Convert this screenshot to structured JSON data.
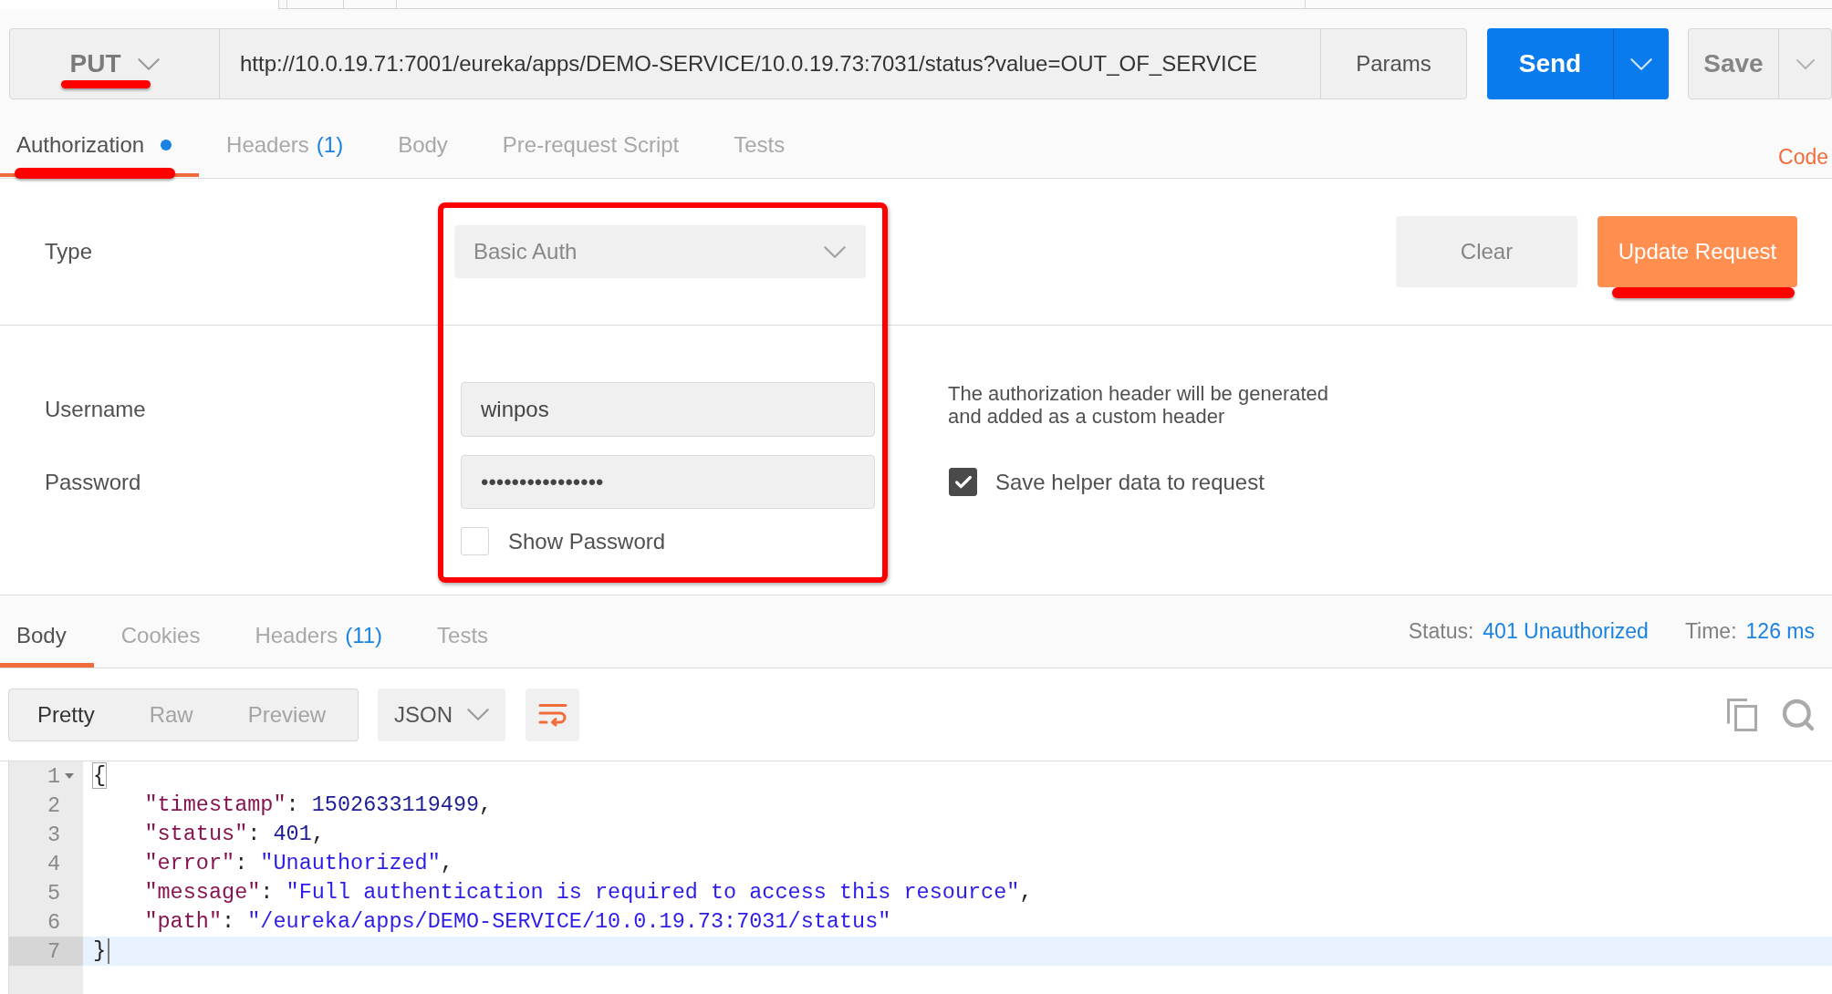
{
  "request": {
    "method": {
      "label": "PUT",
      "marked": true
    },
    "url": "http://10.0.19.71:7001/eureka/apps/DEMO-SERVICE/10.0.19.73:7031/status?value=OUT_OF_SERVICE",
    "params": "Params",
    "send": "Send",
    "save": "Save"
  },
  "request_tabs": [
    {
      "label": "Authorization",
      "selected": true,
      "modified": true,
      "marked": true
    },
    {
      "label": "Headers",
      "count": "(1)",
      "selected": false,
      "modified": false,
      "marked": false
    },
    {
      "label": "Body",
      "selected": false,
      "modified": false,
      "marked": false
    },
    {
      "label": "Pre-request Script",
      "selected": false,
      "modified": false,
      "marked": false
    },
    {
      "label": "Tests",
      "selected": false,
      "modified": false,
      "marked": false
    }
  ],
  "code_link": "Code",
  "auth": {
    "type_label": "Type",
    "type_value": "Basic Auth",
    "fields_marked": true,
    "buttons": [
      {
        "label": "Clear",
        "kind": "secondary",
        "marked": false
      },
      {
        "label": "Update Request",
        "kind": "primary",
        "marked": true
      }
    ],
    "username_label": "Username",
    "username": "winpos",
    "password_label": "Password",
    "password": "••••••••••••••••",
    "show_password": {
      "label": "Show Password",
      "checked": false
    },
    "note": "The authorization header will be generated and added as a custom header",
    "save_helper": {
      "label": "Save helper data to request",
      "checked": true
    }
  },
  "response": {
    "tabs": [
      {
        "label": "Body",
        "selected": true
      },
      {
        "label": "Cookies",
        "selected": false
      },
      {
        "label": "Headers",
        "count": "(11)",
        "selected": false
      },
      {
        "label": "Tests",
        "selected": false
      }
    ],
    "status_label": "Status:",
    "status": "401 Unauthorized",
    "time_label": "Time:",
    "time": "126 ms",
    "view_modes": [
      {
        "label": "Pretty",
        "selected": true
      },
      {
        "label": "Raw",
        "selected": false
      },
      {
        "label": "Preview",
        "selected": false
      }
    ],
    "format": "JSON",
    "wrap_lines": true,
    "lines": [
      {
        "number": "1",
        "foldable": true,
        "current": false,
        "tokens": [
          {
            "kind": "brace",
            "text": "{",
            "matched": true
          }
        ]
      },
      {
        "number": "2",
        "foldable": false,
        "current": false,
        "tokens": [
          {
            "kind": "key",
            "text": "    \"timestamp\"",
            "matched": false
          },
          {
            "kind": "punct",
            "text": ": ",
            "matched": false
          },
          {
            "kind": "number",
            "text": "1502633119499",
            "matched": false
          },
          {
            "kind": "punct",
            "text": ",",
            "matched": false
          }
        ]
      },
      {
        "number": "3",
        "foldable": false,
        "current": false,
        "tokens": [
          {
            "kind": "key",
            "text": "    \"status\"",
            "matched": false
          },
          {
            "kind": "punct",
            "text": ": ",
            "matched": false
          },
          {
            "kind": "number",
            "text": "401",
            "matched": false
          },
          {
            "kind": "punct",
            "text": ",",
            "matched": false
          }
        ]
      },
      {
        "number": "4",
        "foldable": false,
        "current": false,
        "tokens": [
          {
            "kind": "key",
            "text": "    \"error\"",
            "matched": false
          },
          {
            "kind": "punct",
            "text": ": ",
            "matched": false
          },
          {
            "kind": "string",
            "text": "\"Unauthorized\"",
            "matched": false
          },
          {
            "kind": "punct",
            "text": ",",
            "matched": false
          }
        ]
      },
      {
        "number": "5",
        "foldable": false,
        "current": false,
        "tokens": [
          {
            "kind": "key",
            "text": "    \"message\"",
            "matched": false
          },
          {
            "kind": "punct",
            "text": ": ",
            "matched": false
          },
          {
            "kind": "string",
            "text": "\"Full authentication is required to access this resource\"",
            "matched": false
          },
          {
            "kind": "punct",
            "text": ",",
            "matched": false
          }
        ]
      },
      {
        "number": "6",
        "foldable": false,
        "current": false,
        "tokens": [
          {
            "kind": "key",
            "text": "    \"path\"",
            "matched": false
          },
          {
            "kind": "punct",
            "text": ": ",
            "matched": false
          },
          {
            "kind": "string",
            "text": "\"/eureka/apps/DEMO-SERVICE/10.0.19.73:7031/status\"",
            "matched": false
          }
        ]
      },
      {
        "number": "7",
        "foldable": false,
        "current": true,
        "tokens": [
          {
            "kind": "brace",
            "text": "}",
            "matched": false
          }
        ]
      }
    ]
  }
}
